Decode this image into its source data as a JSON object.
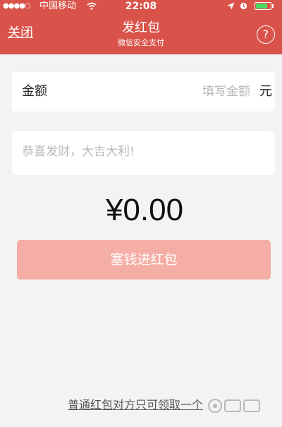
{
  "status_bar": {
    "signal": "●●●●○",
    "carrier": "中国移动",
    "time": "22:08",
    "battery_level": 0.8,
    "battery_color": "#4cd964"
  },
  "nav": {
    "close_label": "关闭",
    "title": "发红包",
    "subtitle": "微信安全支付",
    "help_label": "?"
  },
  "amount": {
    "label": "金额",
    "placeholder": "填写金额",
    "value": "",
    "unit": "元"
  },
  "message": {
    "placeholder": "恭喜发财，大吉大利!",
    "value": ""
  },
  "total": "¥0.00",
  "submit_label": "塞钱进红包",
  "footer_note": "普通红包对方只可领取一个",
  "icons": {
    "wifi": "wifi-icon",
    "location": "location-icon",
    "alarm": "alarm-icon",
    "battery": "battery-icon",
    "help": "help-icon"
  },
  "colors": {
    "header": "#d9534a",
    "button": "#f5aea5",
    "background": "#f3f3f3"
  }
}
